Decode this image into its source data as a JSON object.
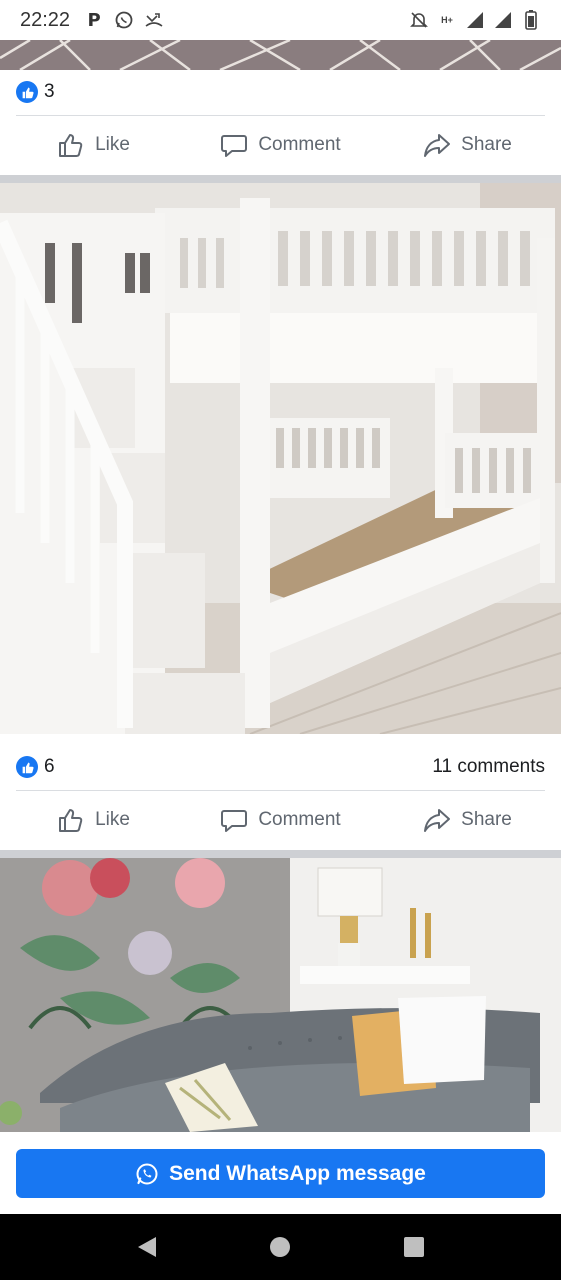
{
  "status_bar": {
    "time": "22:22",
    "left_icons": [
      "p-icon",
      "whatsapp-icon",
      "missed-call-icon"
    ],
    "network_label": "H+",
    "right_icons": [
      "mute-icon",
      "network-icon",
      "signal-icon",
      "signal-icon",
      "battery-icon"
    ]
  },
  "posts": [
    {
      "reactions_count": "3",
      "actions": {
        "like": "Like",
        "comment": "Comment",
        "share": "Share"
      }
    },
    {
      "reactions_count": "6",
      "comments_count": "11 comments",
      "actions": {
        "like": "Like",
        "comment": "Comment",
        "share": "Share"
      }
    }
  ],
  "whatsapp_button": {
    "label": "Send WhatsApp message",
    "color": "#1877f2"
  },
  "nav_bar": {
    "buttons": [
      "back",
      "home",
      "recents"
    ]
  },
  "colors": {
    "accent": "#1877f2",
    "action_text": "#606770",
    "divider": "#dadde1"
  }
}
